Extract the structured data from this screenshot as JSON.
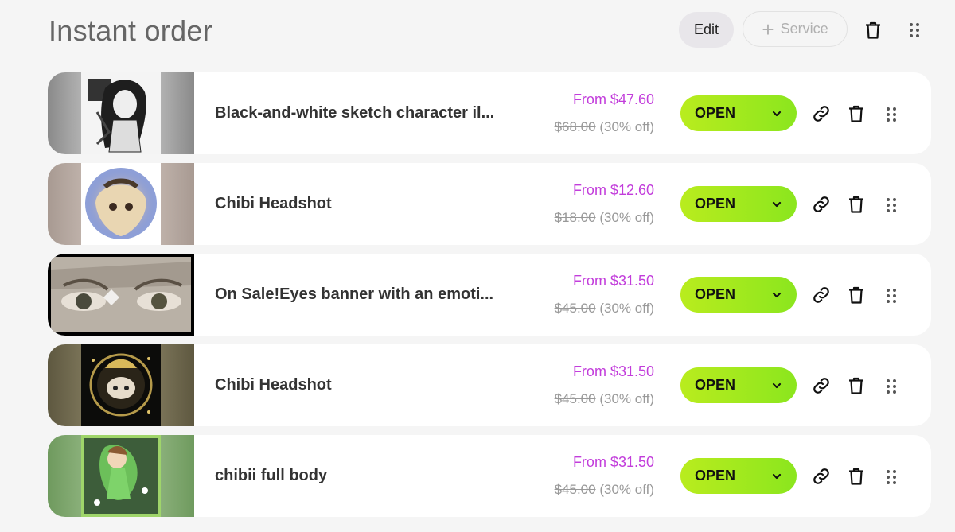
{
  "header": {
    "title": "Instant order",
    "edit_label": "Edit",
    "service_label": "Service",
    "icons": [
      "trash-icon",
      "drag-handle-icon"
    ]
  },
  "colors": {
    "price": "#c23ddb",
    "open_button_start": "#b9ec1e",
    "open_button_end": "#8be61e",
    "background": "#f5f5f5"
  },
  "services": [
    {
      "name": "Black-and-white sketch character il...",
      "price": "From $47.60",
      "original": "$68.00",
      "discount": "(30% off)",
      "status": "OPEN"
    },
    {
      "name": "Chibi Headshot",
      "price": "From $12.60",
      "original": "$18.00",
      "discount": "(30% off)",
      "status": "OPEN"
    },
    {
      "name": "On Sale!Eyes banner with an emoti...",
      "price": "From $31.50",
      "original": "$45.00",
      "discount": "(30% off)",
      "status": "OPEN"
    },
    {
      "name": "Chibi Headshot",
      "price": "From $31.50",
      "original": "$45.00",
      "discount": "(30% off)",
      "status": "OPEN"
    },
    {
      "name": "chibii full body",
      "price": "From $31.50",
      "original": "$45.00",
      "discount": "(30% off)",
      "status": "OPEN"
    }
  ]
}
